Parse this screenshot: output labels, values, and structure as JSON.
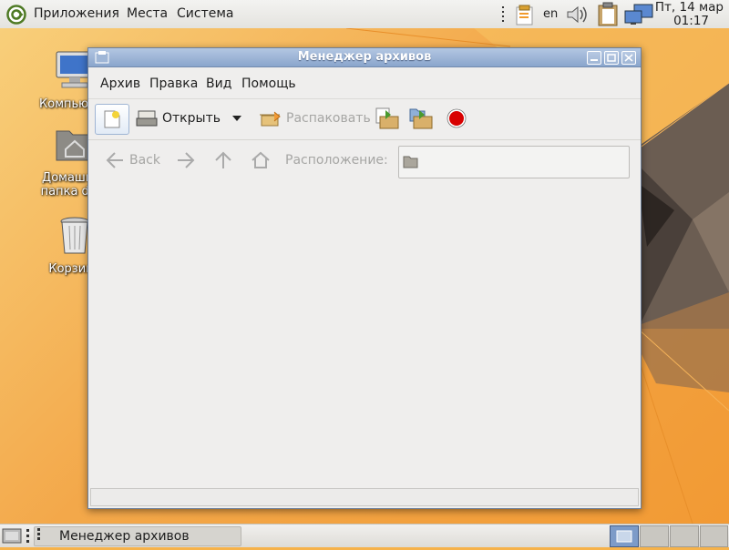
{
  "top_panel": {
    "menus": [
      "Приложения",
      "Места",
      "Система"
    ],
    "keyboard_layout": "en",
    "clock": {
      "date": "Пт, 14 мар",
      "time": "01:17"
    }
  },
  "desktop": {
    "icons": [
      {
        "label": "Компьютер",
        "icon": "computer-icon"
      },
      {
        "label": "Домашняя папка drag",
        "icon": "home-folder-icon"
      },
      {
        "label": "Корзина",
        "icon": "trash-icon"
      }
    ]
  },
  "window": {
    "title": "Менеджер архивов",
    "menu": [
      "Архив",
      "Правка",
      "Вид",
      "Помощь"
    ],
    "toolbar": {
      "open_label": "Открыть",
      "extract_label": "Распаковать"
    },
    "location_bar": {
      "back_label": "Back",
      "location_label": "Расположение:",
      "location_value": ""
    },
    "status_text": ""
  },
  "bottom_panel": {
    "task_title": "Менеджер архивов"
  },
  "colors": {
    "titlebar": "#8aa5cc",
    "desktop_accent": "#f29a34",
    "stop_red": "#d80000"
  }
}
